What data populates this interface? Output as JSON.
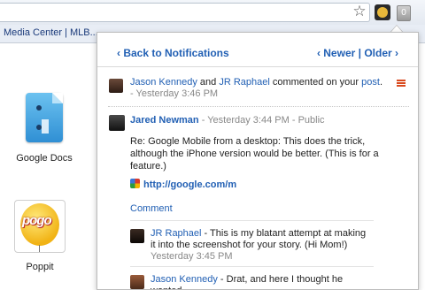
{
  "browser": {
    "bookmark": "Media Center | MLB....",
    "notification_count": "0",
    "star_icon": "star-icon",
    "extension_icon": "extension-icon"
  },
  "apps": [
    {
      "label": "Google Docs"
    },
    {
      "label": "Poppit",
      "logo_text": "pogo"
    }
  ],
  "panel": {
    "back_label": "‹ Back to Notifications",
    "newer_label": "‹ Newer",
    "pager_sep": " | ",
    "older_label": "Older ›",
    "summary": {
      "user1": "Jason Kennedy",
      "and": " and ",
      "user2": "JR Raphael",
      "action": " commented on your ",
      "post_word": "post",
      "dot": ".",
      "dash": " - ",
      "time": "Yesterday 3:46 PM"
    },
    "post": {
      "author": "Jared Newman",
      "dash1": " - ",
      "time": "Yesterday 3:44 PM",
      "dash2": " - ",
      "visibility": "Public",
      "body": "Re: Google Mobile from a desktop: This does the trick, although the iPhone version would be better. (This is for a feature.)",
      "link": "http://google.com/m"
    },
    "comment_label": "Comment",
    "comments": [
      {
        "author": "JR Raphael",
        "text": " - This is my blatant attempt at making it into the screenshot for your story. (Hi Mom!)",
        "time": "Yesterday 3:45 PM"
      },
      {
        "author": "Jason Kennedy",
        "text": " - Drat, and here I thought he wanted"
      }
    ]
  }
}
